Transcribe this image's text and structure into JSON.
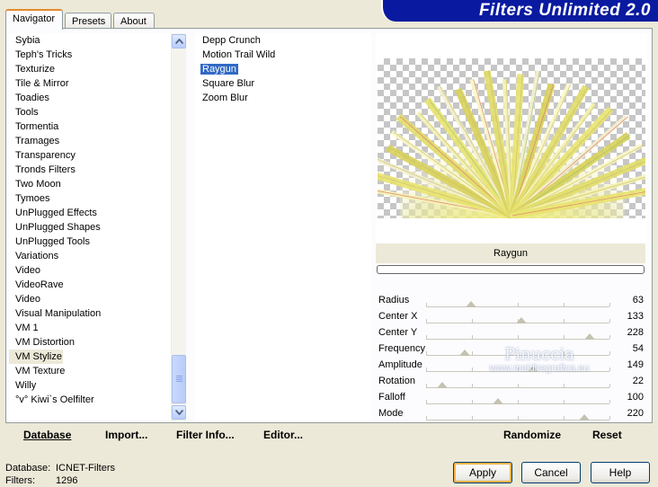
{
  "app": {
    "banner_title": "Filters Unlimited 2.0"
  },
  "tabs": [
    {
      "label": "Navigator",
      "active": true
    },
    {
      "label": "Presets",
      "active": false
    },
    {
      "label": "About",
      "active": false
    }
  ],
  "categories": [
    "Sybia",
    "Teph's Tricks",
    "Texturize",
    "Tile & Mirror",
    "Toadies",
    "Tools",
    "Tormentia",
    "Tramages",
    "Transparency",
    "Tronds Filters",
    "Two Moon",
    "Tymoes",
    "UnPlugged Effects",
    "UnPlugged Shapes",
    "UnPlugged Tools",
    "Variations",
    "Video",
    "VideoRave",
    "Video",
    "Visual Manipulation",
    "VM 1",
    "VM Distortion",
    "VM Stylize",
    "VM Texture",
    "Willy",
    "°v° Kiwi`s Oelfilter"
  ],
  "selected_category": "VM Stylize",
  "filters": [
    "Depp Crunch",
    "Motion Trail Wild",
    "Raygun",
    "Square Blur",
    "Zoom Blur"
  ],
  "selected_filter": "Raygun",
  "preview": {
    "filter_name": "Raygun",
    "progress": 0
  },
  "params": [
    {
      "label": "Radius",
      "value": 63
    },
    {
      "label": "Center X",
      "value": 133
    },
    {
      "label": "Center Y",
      "value": 228
    },
    {
      "label": "Frequency",
      "value": 54
    },
    {
      "label": "Amplitude",
      "value": 149
    },
    {
      "label": "Rotation",
      "value": 22
    },
    {
      "label": "Falloff",
      "value": 100
    },
    {
      "label": "Mode",
      "value": 220
    }
  ],
  "left_buttons": {
    "database": "Database",
    "import": "Import...",
    "filter_info": "Filter Info...",
    "editor": "Editor..."
  },
  "right_buttons": {
    "randomize": "Randomize",
    "reset": "Reset"
  },
  "footer": {
    "database_label": "Database:",
    "database_value": "ICNET-Filters",
    "filters_label": "Filters:",
    "filters_value": "1296"
  },
  "dialog_buttons": {
    "apply": "Apply",
    "cancel": "Cancel",
    "help": "Help"
  },
  "watermark": {
    "line1": "Pinuccia",
    "line2": "www.maidiregrafica.eu"
  },
  "colors": {
    "banner_bg": "#0a1aa0",
    "selection": "#316ac5",
    "dialog_bg": "#ece9d8"
  }
}
